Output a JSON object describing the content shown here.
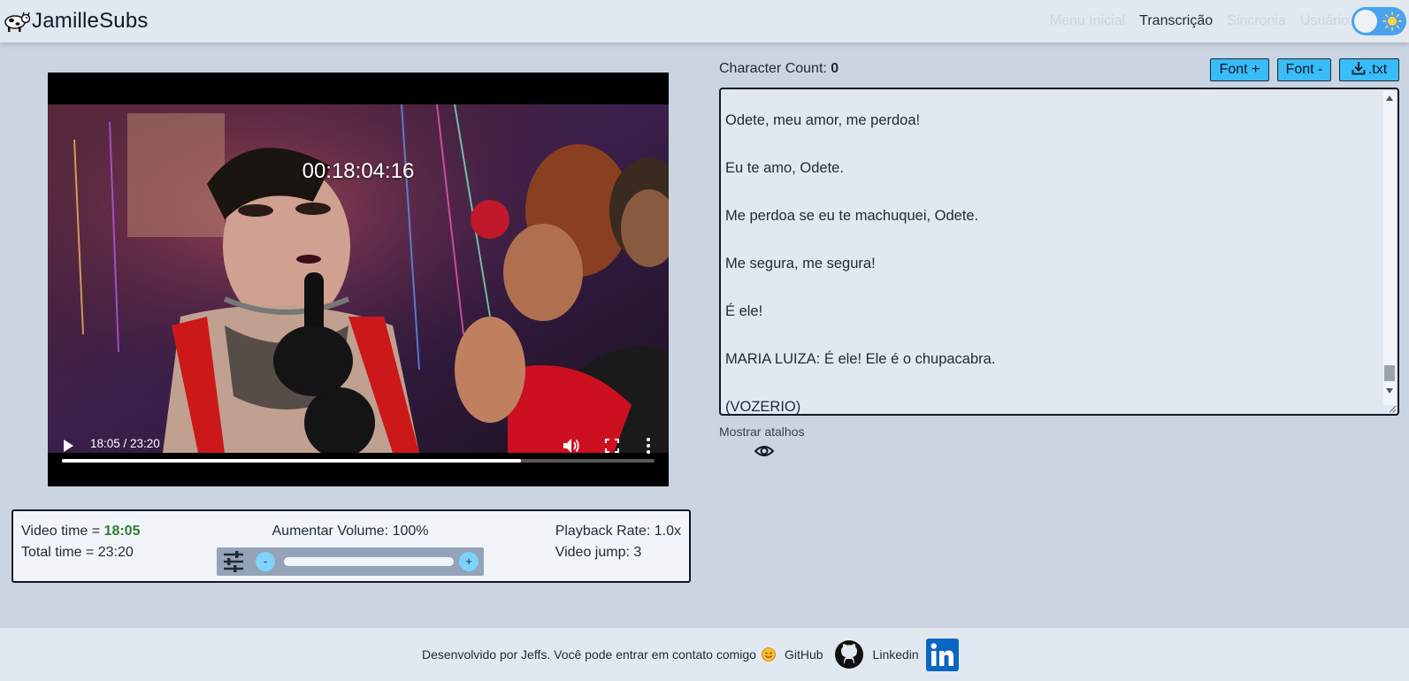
{
  "navbar": {
    "brand": "JamilleSubs",
    "links": [
      {
        "label": "Menu Inicial",
        "active": false
      },
      {
        "label": "Transcrição",
        "active": true
      },
      {
        "label": "Sincronia",
        "active": false
      },
      {
        "label": "Usuário",
        "active": false
      }
    ]
  },
  "video": {
    "overlay_timecode": "00:18:04:16",
    "time_display": "18:05 / 23:20",
    "progress": 0.775
  },
  "info": {
    "video_time_label": "Video time = ",
    "video_time_value": "18:05",
    "total_time": "Total time = 23:20",
    "volume_label": "Aumentar Volume: 100%",
    "volume_minus": "-",
    "volume_plus": "+",
    "playback_rate": "Playback Rate: 1.0x",
    "video_jump": "Video jump: 3"
  },
  "editor": {
    "char_count_label": "Character Count:",
    "char_count_value": "0",
    "font_plus": "Font +",
    "font_minus": "Font -",
    "download": ".txt",
    "lines": [
      "Odete, meu amor, me perdoa!",
      "",
      "Eu te amo, Odete.",
      "",
      "Me perdoa se eu te machuquei, Odete.",
      "",
      "Me segura, me segura!",
      "",
      "É ele!",
      "",
      "MARIA LUIZA: É ele! Ele é o chupacabra.",
      "",
      "(VOZERIO)"
    ],
    "shortcuts_label": "Mostrar atalhos"
  },
  "footer": {
    "text": "Desenvolvido por Jeffs. Você pode entrar em contato comigo",
    "github": "GitHub",
    "linkedin": "Linkedin"
  },
  "colors": {
    "accent": "#38bdf8",
    "toggle": "#4aa3f0",
    "video_time_green": "#2e7d32",
    "linkedin": "#0a66c2"
  }
}
